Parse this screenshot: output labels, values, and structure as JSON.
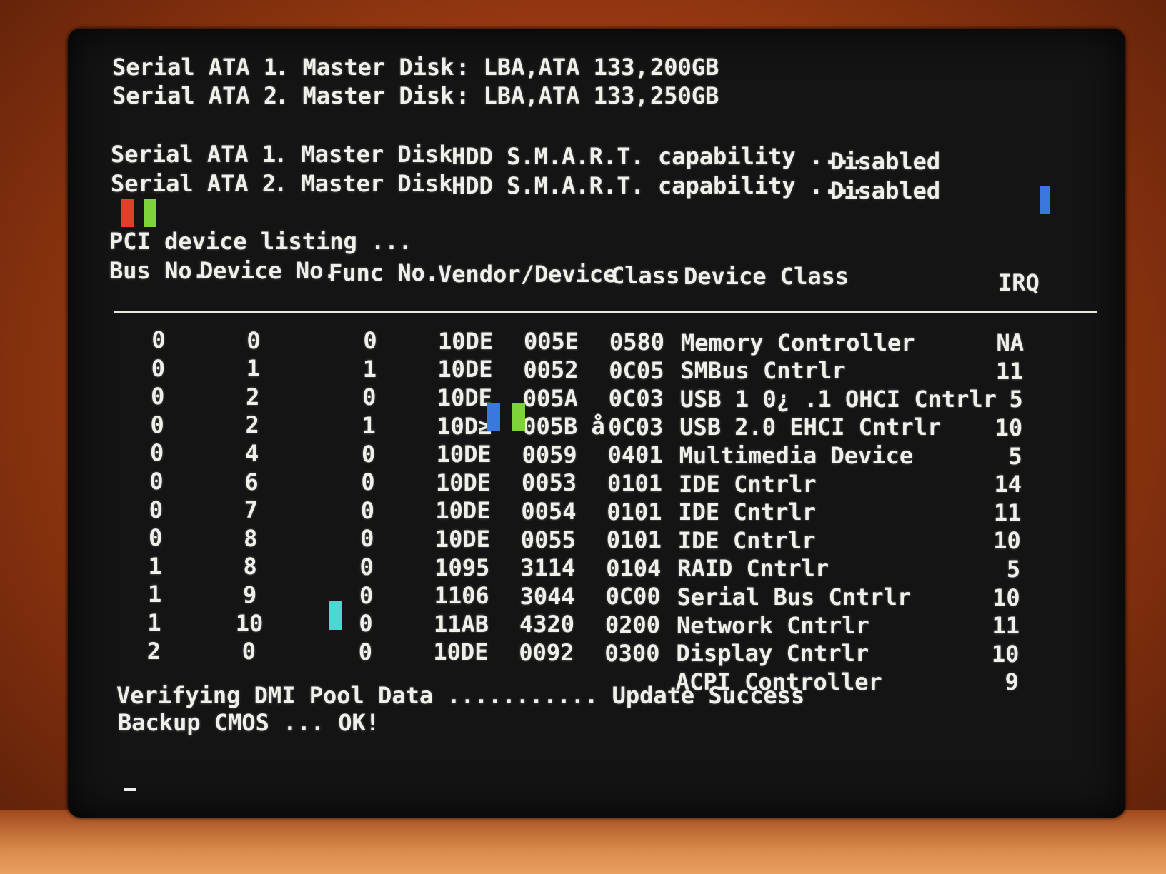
{
  "sata_info": [
    {
      "port": "Serial ATA 1",
      "role": ". Master Disk",
      "detail": ": LBA,ATA 133,",
      "size": "200GB"
    },
    {
      "port": "Serial ATA 2",
      "role": ". Master Disk",
      "detail": ": LBA,ATA 133,",
      "size": "250GB"
    }
  ],
  "smart_info": [
    {
      "port": "Serial ATA 1",
      "role": ". Master Disk",
      "text": "HDD S.M.A.R.T. capability ....",
      "status": "Disabled"
    },
    {
      "port": "Serial ATA 2",
      "role": ". Master Disk",
      "text": "HDD S.M.A.R.T. capability ....",
      "status": "Disabled"
    }
  ],
  "pci_title": "PCI device listing ...",
  "pci_headers": {
    "bus": "Bus No.",
    "device": "Device No.",
    "func": "Func No.",
    "vendor_device": "Vendor/Device",
    "class": "Class",
    "device_class": "Device Class",
    "irq": "IRQ"
  },
  "pci_rows": [
    {
      "bus": "0",
      "dev": "0",
      "func": "0",
      "vendor": "10DE",
      "device": "005E",
      "class": "0580",
      "name": "Memory Controller",
      "irq": "NA"
    },
    {
      "bus": "0",
      "dev": "1",
      "func": "1",
      "vendor": "10DE",
      "device": "0052",
      "class": "0C05",
      "name": "SMBus Cntrlr",
      "irq": "11"
    },
    {
      "bus": "0",
      "dev": "2",
      "func": "0",
      "vendor": "10DE",
      "device": "005A",
      "class": "0C03",
      "name": "USB 1 0¿ .1 OHCI Cntrlr",
      "irq": "5"
    },
    {
      "bus": "0",
      "dev": "2",
      "func": "1",
      "vendor": "10D≥",
      "device": "005B å",
      "class": "0C03",
      "name": "USB 2.0 EHCI Cntrlr",
      "irq": "10"
    },
    {
      "bus": "0",
      "dev": "4",
      "func": "0",
      "vendor": "10DE",
      "device": "0059",
      "class": "0401",
      "name": "Multimedia Device",
      "irq": "5"
    },
    {
      "bus": "0",
      "dev": "6",
      "func": "0",
      "vendor": "10DE",
      "device": "0053",
      "class": "0101",
      "name": "IDE Cntrlr",
      "irq": "14"
    },
    {
      "bus": "0",
      "dev": "7",
      "func": "0",
      "vendor": "10DE",
      "device": "0054",
      "class": "0101",
      "name": "IDE Cntrlr",
      "irq": "11"
    },
    {
      "bus": "0",
      "dev": "8",
      "func": "0",
      "vendor": "10DE",
      "device": "0055",
      "class": "0101",
      "name": "IDE Cntrlr",
      "irq": "10"
    },
    {
      "bus": "1",
      "dev": "8",
      "func": "0",
      "vendor": "1095",
      "device": "3114",
      "class": "0104",
      "name": "RAID Cntrlr",
      "irq": "5"
    },
    {
      "bus": "1",
      "dev": "9",
      "func": "0",
      "vendor": "1106",
      "device": "3044",
      "class": "0C00",
      "name": "Serial Bus Cntrlr",
      "irq": "10"
    },
    {
      "bus": "1",
      "dev": "10",
      "func": "0",
      "vendor": "11AB",
      "device": "4320",
      "class": "0200",
      "name": "Network Cntrlr",
      "irq": "11"
    },
    {
      "bus": "2",
      "dev": "0",
      "func": "0",
      "vendor": "10DE",
      "device": "0092",
      "class": "0300",
      "name": "Display Cntrlr",
      "irq": "10"
    },
    {
      "bus": "",
      "dev": "",
      "func": "",
      "vendor": "",
      "device": "",
      "class": "",
      "name": "ACPI Controller",
      "irq": "9"
    }
  ],
  "status_lines": {
    "dmi": "Verifying DMI Pool Data ........... Update Success",
    "cmos": "Backup CMOS ... OK!"
  },
  "colors": {
    "text": "#f0f0ea",
    "screen_bg": "#141414",
    "glitch_red": "#e0402a",
    "glitch_green": "#7ed23a",
    "glitch_blue": "#3a78e0",
    "glitch_cyan": "#4ad8d0"
  }
}
